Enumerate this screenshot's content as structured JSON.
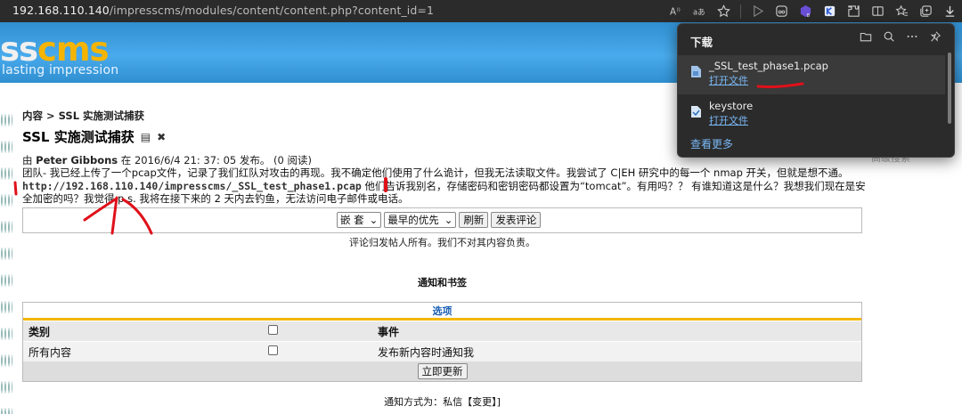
{
  "browser": {
    "url_host": "192.168.110.140",
    "url_path": "/impresscms/modules/content/content.php?content_id=1"
  },
  "site": {
    "logo_ss": "ss",
    "logo_cms": "cms",
    "tagline": "lasting impression"
  },
  "article": {
    "breadcrumb": "内容 > SSL 实施测试捕获",
    "title": "SSL 实施测试捕获",
    "meta_prefix": "由 ",
    "author": "Peter Gibbons",
    "meta_suffix": " 在 2016/6/4 21: 37: 05 发布。 (0 阅读)",
    "body_1": "团队- 我已经上传了一个pcap文件，记录了我们红队对攻击的再现。我不确定他们使用了什么诡计，但我无法读取文件。我尝试了 C|EH 研究中的每一个 nmap 开关，但就是想不通。",
    "body_link": "http://192.168.110.140/impresscms/_SSL_test_phase1.pcap",
    "body_2": " 他们告诉我别名，存储密码和密钥密码都设置为“tomcat”。有用吗？？ 有谁知道这是什么？我想我们现在是安全加密的吗？我觉得 p.s. 我将在接下来的 2 天内去钓鱼，无法访问电子邮件或电话。"
  },
  "comments": {
    "mode_select": "嵌 套",
    "order_select": "最早的优先",
    "refresh_label": "刷新",
    "post_label": "发表评论",
    "disclaimer": "评论归发帖人所有。我们不对其内容负责。"
  },
  "notifications": {
    "section_title": "通知和书签",
    "table_title": "选项",
    "col_category": "类别",
    "col_event": "事件",
    "row_category": "所有内容",
    "row_event": "发布新内容时通知我",
    "update_label": "立即更新",
    "method_text": "通知方式为：私信【变更】]"
  },
  "right_sidebar_text": "高级搜索",
  "downloads": {
    "title": "下载",
    "items": [
      {
        "name": "_SSL_test_phase1.pcap",
        "action": "打开文件"
      },
      {
        "name": "keystore",
        "action": "打开文件"
      }
    ],
    "see_more": "查看更多"
  },
  "colors": {
    "header_blue": "#49aaec",
    "logo_orange": "#f5b400",
    "accent_yellow": "#f2b705",
    "annotation_red": "#e0101a"
  }
}
